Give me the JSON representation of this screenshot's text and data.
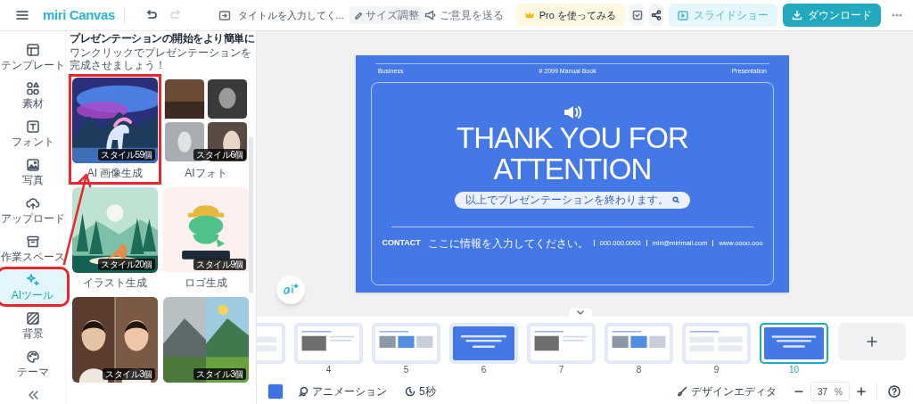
{
  "header": {
    "logo": "miri Canvas",
    "title": "タイトルを入力してく...",
    "resize": "サイズ調整",
    "feedback": "ご意見を送る",
    "pro": "Pro を使ってみる",
    "slideshow": "スライドショー",
    "download": "ダウンロード"
  },
  "rail": [
    {
      "label": "テンプレート",
      "selected": false,
      "annotated": false
    },
    {
      "label": "素材",
      "selected": false,
      "annotated": false
    },
    {
      "label": "フォント",
      "selected": false,
      "annotated": false
    },
    {
      "label": "写真",
      "selected": false,
      "annotated": false
    },
    {
      "label": "アップロード",
      "selected": false,
      "annotated": false
    },
    {
      "label": "作業スペース",
      "selected": false,
      "annotated": false
    },
    {
      "label": "AIツール",
      "selected": true,
      "annotated": true
    },
    {
      "label": "背景",
      "selected": false,
      "annotated": false
    },
    {
      "label": "テーマ",
      "selected": false,
      "annotated": false
    }
  ],
  "panel": {
    "heading": "プレゼンテーションの開始をより簡単に",
    "subheading": "ワンクリックでプレゼンテーションを完成させましょう！",
    "tools": [
      {
        "label": "AI 画像生成",
        "badge": "スタイル59個",
        "annotated": true
      },
      {
        "label": "AIフォト",
        "badge": "スタイル6個",
        "annotated": false
      },
      {
        "label": "イラスト生成",
        "badge": "スタイル20個",
        "annotated": false
      },
      {
        "label": "ロゴ生成",
        "badge": "スタイル9個",
        "annotated": false
      },
      {
        "badge": "スタイル3個",
        "annotated": false
      },
      {
        "badge": "スタイル3個",
        "annotated": false
      }
    ]
  },
  "slide": {
    "header_left": "Business",
    "header_center": "# 2099 Manual Book",
    "header_right": "Presentation",
    "title": "THANK YOU FOR ATTENTION",
    "pill": "以上でプレゼンテーションを終わります。",
    "contact_label": "CONTACT",
    "contact_items": [
      "ここに情報を入力してください。",
      "000.000.0000",
      "miri@mirimail.com",
      "www.oooo.ooo"
    ]
  },
  "thumbnails": [
    {
      "kind": "light",
      "selected": false
    },
    {
      "number": "4",
      "kind": "light",
      "selected": false
    },
    {
      "number": "5",
      "kind": "light",
      "selected": false
    },
    {
      "number": "6",
      "kind": "blue",
      "selected": false
    },
    {
      "number": "7",
      "kind": "light",
      "selected": false
    },
    {
      "number": "8",
      "kind": "light",
      "selected": false
    },
    {
      "number": "9",
      "kind": "light",
      "selected": false
    },
    {
      "number": "10",
      "kind": "blue",
      "selected": true
    }
  ],
  "footer": {
    "color": "#3f73e4",
    "animation": "アニメーション",
    "duration": "5秒",
    "design_editor": "デザインエディタ",
    "zoom": "37",
    "zoom_unit": "%"
  }
}
